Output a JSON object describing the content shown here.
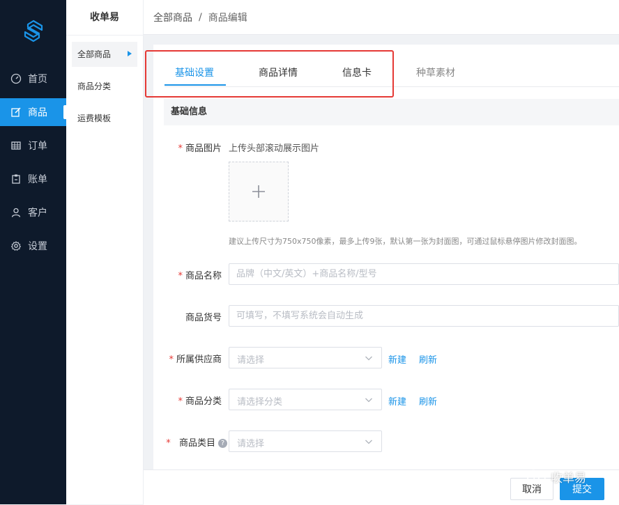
{
  "nav": {
    "items": [
      {
        "label": "首页",
        "icon": "dashboard-icon"
      },
      {
        "label": "商品",
        "icon": "edit-icon",
        "active": true
      },
      {
        "label": "订单",
        "icon": "table-icon"
      },
      {
        "label": "账单",
        "icon": "clipboard-icon"
      },
      {
        "label": "客户",
        "icon": "user-icon"
      },
      {
        "label": "设置",
        "icon": "gear-icon"
      }
    ]
  },
  "subnav": {
    "title": "收单易",
    "items": [
      "全部商品",
      "商品分类",
      "运费模板"
    ]
  },
  "breadcrumb": {
    "first": "全部商品",
    "separator": "/",
    "second": "商品编辑"
  },
  "tabs": [
    "基础设置",
    "商品详情",
    "信息卡",
    "种草素材"
  ],
  "section_title": "基础信息",
  "form": {
    "image_label": "商品图片",
    "image_hint": "上传头部滚动展示图片",
    "image_note": "建议上传尺寸为750x750像素，最多上传9张，默认第一张为封面图，可通过鼠标悬停图片修改封面图。",
    "name_label": "商品名称",
    "name_placeholder": "品牌（中文/英文）+商品名称/型号",
    "sku_label": "商品货号",
    "sku_placeholder": "可填写，不填写系统会自动生成",
    "supplier_label": "所属供应商",
    "supplier_placeholder": "请选择",
    "category_label": "商品分类",
    "category_placeholder": "请选择分类",
    "type_label": "商品类目",
    "type_placeholder": "请选择",
    "help_glyph": "?",
    "new_label": "新建",
    "refresh_label": "刷新"
  },
  "actions": {
    "cancel": "取消",
    "submit": "提交"
  },
  "watermark": "收单易",
  "colors": {
    "nav_bg": "#0e1a2b",
    "accent": "#1a94e8",
    "required": "#e53935"
  }
}
